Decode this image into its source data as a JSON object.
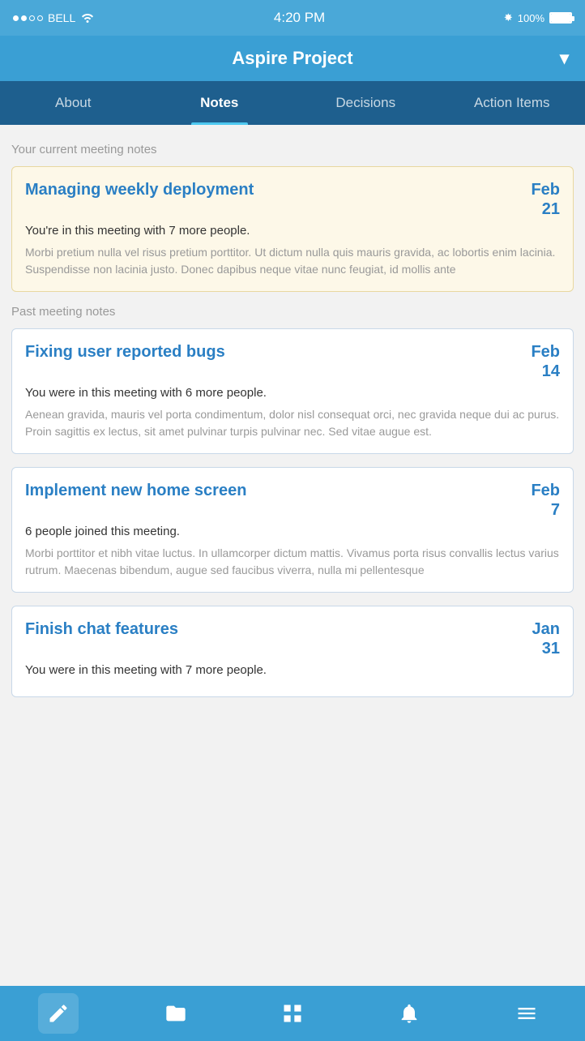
{
  "status": {
    "carrier": "BELL",
    "time": "4:20 PM",
    "battery": "100%"
  },
  "header": {
    "title": "Aspire Project",
    "chevron": "▾"
  },
  "tabs": [
    {
      "id": "about",
      "label": "About",
      "active": false
    },
    {
      "id": "notes",
      "label": "Notes",
      "active": true
    },
    {
      "id": "decisions",
      "label": "Decisions",
      "active": false
    },
    {
      "id": "action-items",
      "label": "Action Items",
      "active": false
    }
  ],
  "sections": {
    "current": {
      "label": "Your current meeting notes",
      "cards": [
        {
          "title": "Managing weekly deployment",
          "date_month": "Feb",
          "date_day": "21",
          "subtitle": "You're in this meeting with 7 more people.",
          "body": "Morbi pretium nulla vel risus pretium porttitor. Ut dictum nulla quis mauris gravida, ac lobortis enim lacinia. Suspendisse non lacinia justo. Donec dapibus neque vitae nunc feugiat, id mollis ante"
        }
      ]
    },
    "past": {
      "label": "Past meeting notes",
      "cards": [
        {
          "title": "Fixing user reported bugs",
          "date_month": "Feb",
          "date_day": "14",
          "subtitle": "You were in this meeting with 6 more people.",
          "body": "Aenean gravida, mauris vel porta condimentum, dolor nisl consequat orci, nec gravida neque dui ac purus. Proin sagittis ex lectus, sit amet pulvinar turpis pulvinar nec. Sed vitae augue est."
        },
        {
          "title": "Implement new home screen",
          "date_month": "Feb",
          "date_day": "7",
          "subtitle": "6 people joined this meeting.",
          "body": "Morbi porttitor et nibh vitae luctus. In ullamcorper dictum mattis. Vivamus porta risus convallis lectus varius rutrum. Maecenas bibendum, augue sed faucibus viverra, nulla mi pellentesque"
        },
        {
          "title": "Finish chat features",
          "date_month": "Jan",
          "date_day": "31",
          "subtitle": "You were in this meeting with 7 more people.",
          "body": ""
        }
      ]
    }
  },
  "bottom_nav": [
    {
      "id": "edit",
      "label": "Edit"
    },
    {
      "id": "folder",
      "label": "Folder"
    },
    {
      "id": "grid",
      "label": "Grid"
    },
    {
      "id": "bell",
      "label": "Notifications"
    },
    {
      "id": "menu",
      "label": "Menu"
    }
  ]
}
